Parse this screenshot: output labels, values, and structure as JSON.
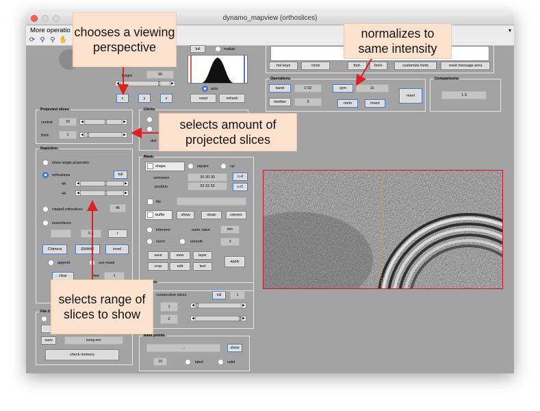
{
  "window": {
    "title": "dynamo_mapview (orthoslices)"
  },
  "menubar": {
    "label": "More operatio"
  },
  "view": {
    "height_label": "height",
    "height_value": "90",
    "x": "x",
    "y": "y",
    "z": "z"
  },
  "histogram": {
    "full": "full",
    "matlab": "matlab",
    "auto": "auto",
    "reset": "reset",
    "refresh": "refresh"
  },
  "top_buttons": {
    "hot_keys": "hot keys",
    "clock": "clock",
    "font": "font-",
    "font2": "font+",
    "customize": "customize fonts",
    "reset_area": "reset message area"
  },
  "operations": {
    "title": "Operations",
    "band": "band",
    "band_value": "0 32",
    "sym": "sym",
    "sym_value": "1k",
    "median": "median",
    "median_value": "3",
    "norm": "norm",
    "invert": "invert",
    "reset": "reset"
  },
  "comparisons": {
    "title": "Comparisons",
    "value": "1.3"
  },
  "projected": {
    "title": "Projected slices",
    "central": "central",
    "central_value": "33",
    "thick": "thick",
    "thick_value": "1"
  },
  "clicks": {
    "title": "Clicks",
    "dist": "dist"
  },
  "depiction": {
    "title": "Depiction",
    "single": "show single projection",
    "orthoslices": "orthoslices",
    "full": "full",
    "v1": "44",
    "v2": "44",
    "rotated": "rotated orthoslices",
    "rot_value": "45",
    "isosurfaces": "isosurfaces",
    "iso_value": "0.5",
    "iso_r": "r",
    "chimera": "Chimera",
    "emanz": "EMAN2",
    "imod": "imod",
    "append": "append",
    "use_mask": "use mask",
    "clear": "clear",
    "view": "view",
    "view_value": "1"
  },
  "file": {
    "title": "File I/",
    "save": "save",
    "save_value": "temp.em",
    "check_memory": "check memory"
  },
  "mask": {
    "title": "Mask",
    "shape": "shape",
    "square": "square",
    "cyl": "cyl",
    "semiaxes": "semiaxes",
    "semiaxes_value": "30 30 30",
    "position": "position",
    "position_value": "33 33 33",
    "cd": "c-d",
    "cc": "c-C",
    "file": "file",
    "buffer": "buffer",
    "show": "show",
    "clean": "clean",
    "convex": "convex",
    "intersect": "intersect",
    "outer_value": "outer value",
    "min": "min",
    "norm": "norm",
    "smooth": "smooth",
    "smooth_value": "3",
    "save": "save",
    "view": "view",
    "layer": "layer",
    "crop": "crop",
    "edit": "edit",
    "test": "test",
    "apply": "apply"
  },
  "particles": {
    "title": "articles",
    "consecutive": "consecutive slices",
    "kill": "kill",
    "kill_value": "1",
    "v1": "1",
    "v2": "2"
  },
  "markpoints": {
    "title": "Mark points",
    "field": "...",
    "show": "show",
    "num": "10",
    "label": "label",
    "solid": "solid"
  },
  "callouts": {
    "perspective": "chooses a viewing perspective",
    "normalize": "normalizes to same intensity",
    "projected": "selects amount of projected slices",
    "range": "selects range of slices to show"
  },
  "colors": {
    "callout_bg": "#fde3cf",
    "arrow": "#e02020",
    "image_border": "#c8151b",
    "panel_bg": "#a3a3a3"
  }
}
